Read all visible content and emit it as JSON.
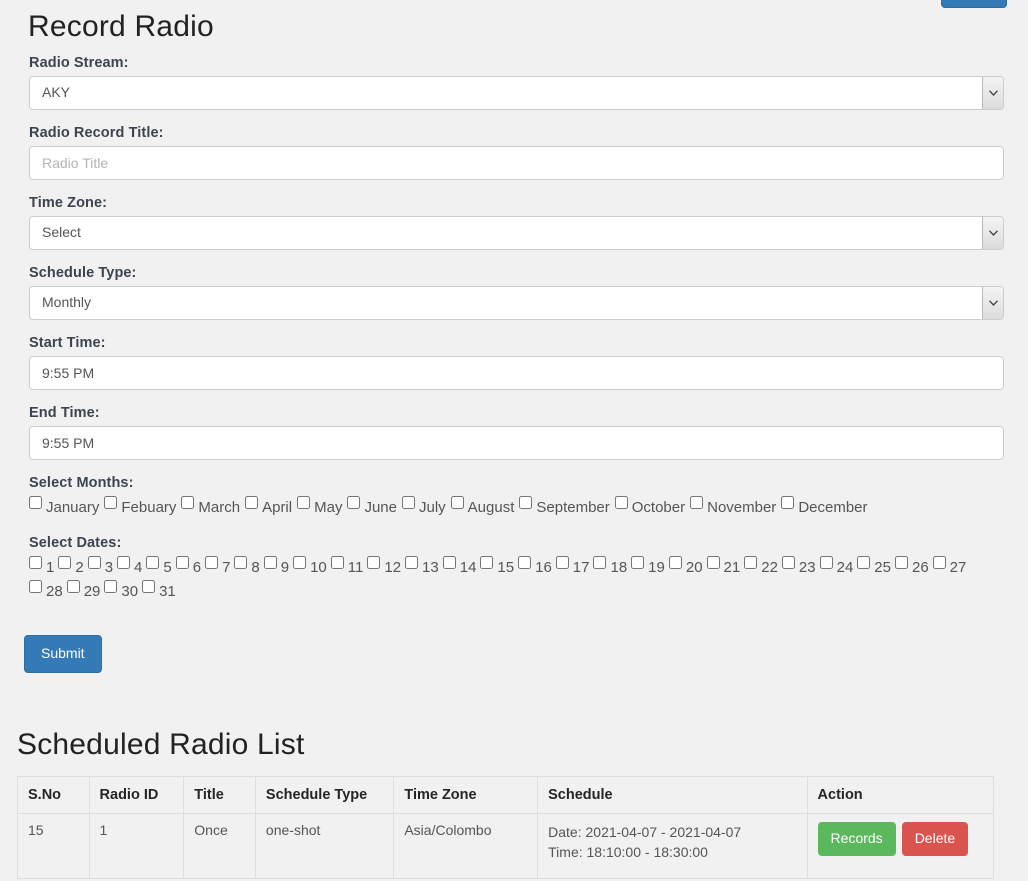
{
  "page": {
    "title": "Record Radio",
    "background_color": "#f1f1f1"
  },
  "top_partial_button": {
    "name": "cut-off-button",
    "color": "#337ab7"
  },
  "form": {
    "radio_stream": {
      "label": "Radio Stream:",
      "value": "AKY",
      "options": [
        "AKY"
      ]
    },
    "radio_record_title": {
      "label": "Radio Record Title:",
      "value": "",
      "placeholder": "Radio Title"
    },
    "time_zone": {
      "label": "Time Zone:",
      "value": "Select",
      "options": [
        "Select"
      ]
    },
    "schedule_type": {
      "label": "Schedule Type:",
      "value": "Monthly",
      "options": [
        "Monthly"
      ]
    },
    "start_time": {
      "label": "Start Time:",
      "value": "9:55 PM"
    },
    "end_time": {
      "label": "End Time:",
      "value": "9:55 PM"
    },
    "select_months": {
      "label": "Select Months:",
      "items": [
        {
          "label": "January",
          "checked": false
        },
        {
          "label": "Febuary",
          "checked": false
        },
        {
          "label": "March",
          "checked": false
        },
        {
          "label": "April",
          "checked": false
        },
        {
          "label": "May",
          "checked": false
        },
        {
          "label": "June",
          "checked": false
        },
        {
          "label": "July",
          "checked": false
        },
        {
          "label": "August",
          "checked": false
        },
        {
          "label": "September",
          "checked": false
        },
        {
          "label": "October",
          "checked": false
        },
        {
          "label": "November",
          "checked": false
        },
        {
          "label": "December",
          "checked": false
        }
      ]
    },
    "select_dates": {
      "label": "Select Dates:",
      "items": [
        {
          "label": "1",
          "checked": false
        },
        {
          "label": "2",
          "checked": false
        },
        {
          "label": "3",
          "checked": false
        },
        {
          "label": "4",
          "checked": false
        },
        {
          "label": "5",
          "checked": false
        },
        {
          "label": "6",
          "checked": false
        },
        {
          "label": "7",
          "checked": false
        },
        {
          "label": "8",
          "checked": false
        },
        {
          "label": "9",
          "checked": false
        },
        {
          "label": "10",
          "checked": false
        },
        {
          "label": "11",
          "checked": false
        },
        {
          "label": "12",
          "checked": false
        },
        {
          "label": "13",
          "checked": false
        },
        {
          "label": "14",
          "checked": false
        },
        {
          "label": "15",
          "checked": false
        },
        {
          "label": "16",
          "checked": false
        },
        {
          "label": "17",
          "checked": false
        },
        {
          "label": "18",
          "checked": false
        },
        {
          "label": "19",
          "checked": false
        },
        {
          "label": "20",
          "checked": false
        },
        {
          "label": "21",
          "checked": false
        },
        {
          "label": "22",
          "checked": false
        },
        {
          "label": "23",
          "checked": false
        },
        {
          "label": "24",
          "checked": false
        },
        {
          "label": "25",
          "checked": false
        },
        {
          "label": "26",
          "checked": false
        },
        {
          "label": "27",
          "checked": false
        },
        {
          "label": "28",
          "checked": false
        },
        {
          "label": "29",
          "checked": false
        },
        {
          "label": "30",
          "checked": false
        },
        {
          "label": "31",
          "checked": false
        }
      ]
    },
    "submit_label": "Submit"
  },
  "scheduled_list": {
    "title": "Scheduled Radio List",
    "columns": [
      "S.No",
      "Radio ID",
      "Title",
      "Schedule Type",
      "Time Zone",
      "Schedule",
      "Action"
    ],
    "rows": [
      {
        "s_no": "15",
        "radio_id": "1",
        "title": "Once",
        "schedule_type": "one-shot",
        "time_zone": "Asia/Colombo",
        "schedule_date": "Date: 2021-04-07 - 2021-04-07",
        "schedule_time": "Time: 18:10:00 - 18:30:00",
        "records_label": "Records",
        "delete_label": "Delete"
      }
    ],
    "colors": {
      "records_button": "#5cb85c",
      "delete_button": "#d9534f"
    }
  }
}
